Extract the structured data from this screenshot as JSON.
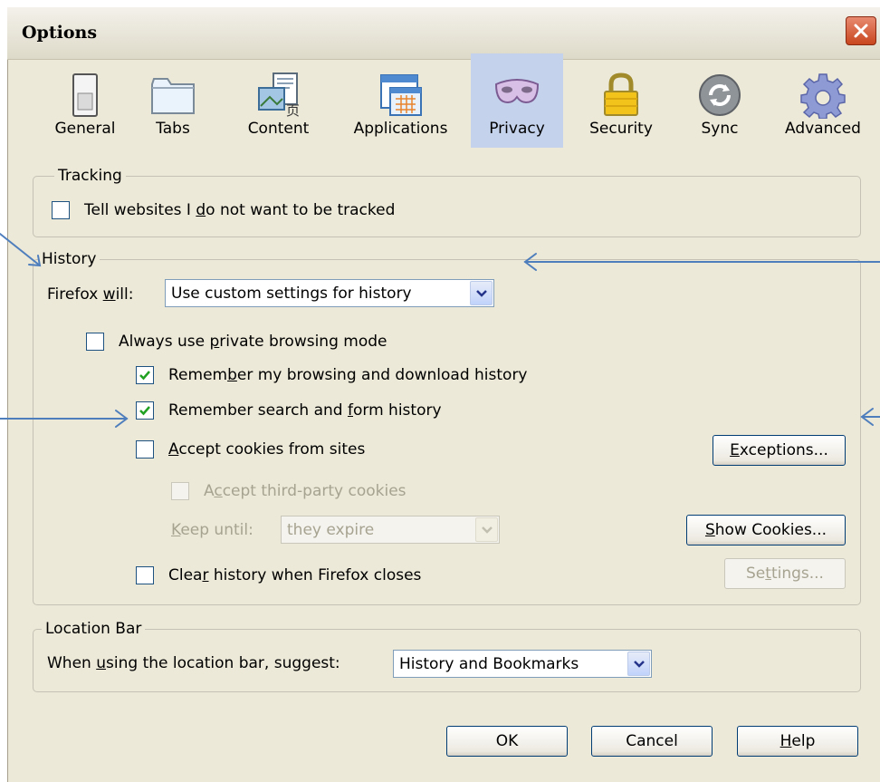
{
  "window": {
    "title": "Options"
  },
  "toolbar": {
    "tabs": [
      {
        "label": "General",
        "icon": "general-icon"
      },
      {
        "label": "Tabs",
        "icon": "tabs-icon"
      },
      {
        "label": "Content",
        "icon": "content-icon"
      },
      {
        "label": "Applications",
        "icon": "applications-icon"
      },
      {
        "label": "Privacy",
        "icon": "privacy-mask-icon",
        "selected": true
      },
      {
        "label": "Security",
        "icon": "padlock-icon"
      },
      {
        "label": "Sync",
        "icon": "sync-icon"
      },
      {
        "label": "Advanced",
        "icon": "gear-icon"
      }
    ]
  },
  "tracking": {
    "legend": "Tracking",
    "do_not_track": {
      "pre": "Tell websites I ",
      "accel": "d",
      "post": "o not want to be tracked",
      "checked": false
    }
  },
  "history": {
    "legend": "History",
    "firefox_will": {
      "pre": "Firefox ",
      "accel": "w",
      "post": "ill:"
    },
    "mode_value": "Use custom settings for history",
    "private_mode": {
      "pre": "Always use ",
      "accel": "p",
      "post": "rivate browsing mode",
      "checked": false
    },
    "remember_browsing": {
      "pre": "Remem",
      "accel": "b",
      "post": "er my browsing and download history",
      "checked": true
    },
    "remember_search": {
      "pre": "Remember search and ",
      "accel": "f",
      "post": "orm history",
      "checked": true
    },
    "accept_cookies": {
      "pre": "",
      "accel": "A",
      "post": "ccept cookies from sites",
      "checked": false
    },
    "exceptions_button": {
      "pre": "",
      "accel": "E",
      "post": "xceptions..."
    },
    "third_party": {
      "pre": "A",
      "accel": "c",
      "post": "cept third-party cookies",
      "checked": false
    },
    "keep_until": {
      "pre": "",
      "accel": "K",
      "post": "eep until:"
    },
    "keep_until_value": "they expire",
    "show_cookies_button": {
      "pre": "",
      "accel": "S",
      "post": "how Cookies..."
    },
    "clear_history": {
      "pre": "Clea",
      "accel": "r",
      "post": " history when Firefox closes",
      "checked": false
    },
    "settings_button": {
      "pre": "Se",
      "accel": "t",
      "post": "tings..."
    }
  },
  "location_bar": {
    "legend": "Location Bar",
    "suggest": {
      "pre": "When ",
      "accel": "u",
      "post": "sing the location bar, suggest:"
    },
    "suggest_value": "History and Bookmarks"
  },
  "footer": {
    "ok_label": "OK",
    "cancel_label": "Cancel",
    "help": {
      "pre": "",
      "accel": "H",
      "post": "elp"
    }
  },
  "colors": {
    "dialog_bg": "#ece9d8",
    "selected_tab": "#c4d2ec",
    "annotation_arrow": "#4f7ebd",
    "check": "#21a121"
  }
}
